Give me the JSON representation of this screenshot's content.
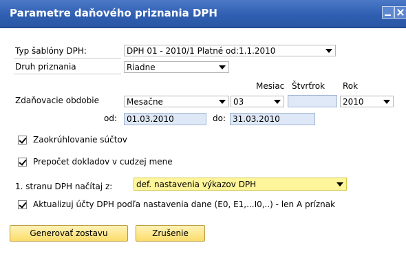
{
  "window": {
    "title": "Parametre daňového priznania DPH"
  },
  "form": {
    "template": {
      "label": "Typ šablóny DPH:",
      "value": "DPH 01 - 2010/1 Platné od:1.1.2010"
    },
    "return_type": {
      "label": "Druh priznania",
      "value": "Riadne"
    },
    "period": {
      "label": "Zdaňovacie obdobie",
      "value": "Mesačne",
      "month_header": "Mesiac",
      "month_value": "03",
      "quarter_header": "Štvrťrok",
      "quarter_value": "",
      "year_header": "Rok",
      "year_value": "2010"
    },
    "date_from": {
      "label": "od:",
      "value": "01.03.2010"
    },
    "date_to": {
      "label": "do:",
      "value": "31.03.2010"
    },
    "rounding": {
      "label": "Zaokrúhlovanie súčtov",
      "checked": true
    },
    "foreign_currency": {
      "label": "Prepočet dokladov v cudzej mene",
      "checked": true
    },
    "first_page": {
      "label": "1. stranu DPH načítaj z:",
      "value": "def. nastavenia výkazov DPH"
    },
    "update_accounts": {
      "label": "Aktualizuj účty DPH podľa nastavenia dane (E0, E1,...I0,..) - len A príznak",
      "checked": true
    }
  },
  "buttons": {
    "generate": "Generovať zostavu",
    "cancel": "Zrušenie"
  },
  "colors": {
    "titlebar": "#2f5fb2",
    "button_fill": "#fbdc6b",
    "highlight_dropdown": "#fff59a",
    "readonly_field": "#dfe8f6"
  }
}
